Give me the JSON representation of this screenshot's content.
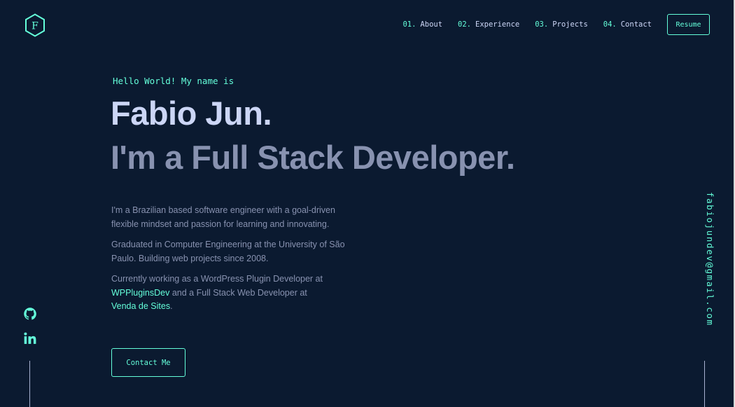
{
  "brand": {
    "logo_letter": "F",
    "accent": "#64ffda",
    "background": "#0b1a30"
  },
  "nav": {
    "items": [
      {
        "num": "01.",
        "label": "About"
      },
      {
        "num": "02.",
        "label": "Experience"
      },
      {
        "num": "03.",
        "label": "Projects"
      },
      {
        "num": "04.",
        "label": "Contact"
      }
    ],
    "resume_label": "Resume"
  },
  "hero": {
    "greeting": "Hello World! My name is",
    "name": "Fabio Jun.",
    "role": "I'm a Full Stack Developer.",
    "bio_1": "I'm a Brazilian based software engineer with a goal-driven flexible mindset and passion for learning and innovating.",
    "bio_2": "Graduated in Computer Engineering at the University of São Paulo. Building web projects since 2008.",
    "bio_3_prefix": "Currently working as a WordPress Plugin Developer at ",
    "bio_3_link1": "WPPluginsDev",
    "bio_3_mid": " and a Full Stack Web Developer at ",
    "bio_3_link2": "Venda de Sites",
    "bio_3_suffix": ".",
    "cta_label": "Contact Me"
  },
  "social": {
    "icons": [
      "github-icon",
      "linkedin-icon"
    ]
  },
  "email": "fabiojundev@gmail.com"
}
